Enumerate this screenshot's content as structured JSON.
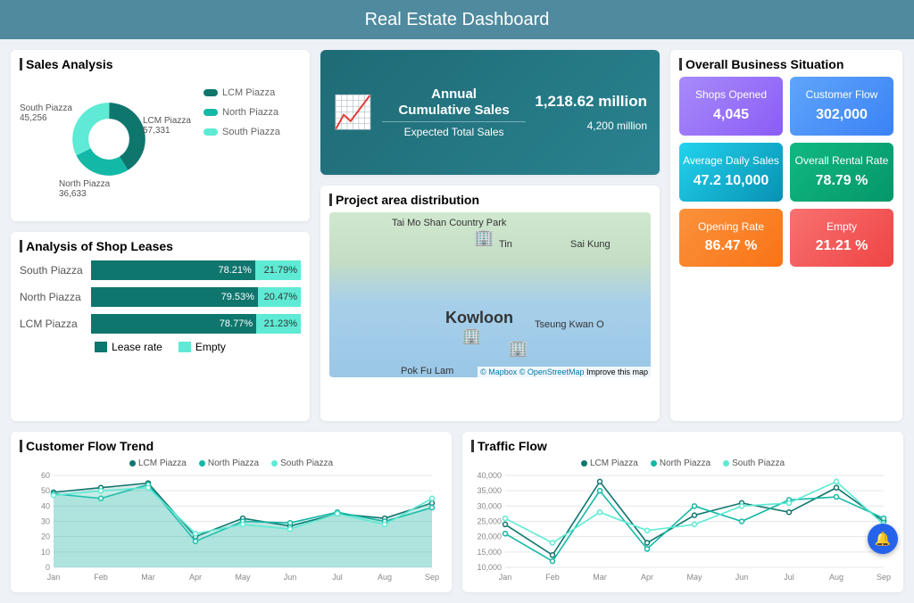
{
  "header": {
    "title": "Real Estate Dashboard"
  },
  "sales_analysis": {
    "title": "Sales Analysis",
    "items": [
      {
        "name": "LCM Piazza",
        "value": 57331,
        "label": "LCM Piazza\n57,331",
        "color": "#0f766e"
      },
      {
        "name": "North Piazza",
        "value": 36633,
        "label": "North Piazza\n36,633",
        "color": "#14b8a6"
      },
      {
        "name": "South Piazza",
        "value": 45256,
        "label": "South Piazza\n45,256",
        "color": "#5eead4"
      }
    ],
    "legend": [
      "LCM Piazza",
      "North Piazza",
      "South Piazza"
    ]
  },
  "kpi": {
    "title_line1": "Annual",
    "title_line2": "Cumulative Sales",
    "value": "1,218.62 million",
    "sub_title": "Expected Total Sales",
    "sub_value": "4,200 million"
  },
  "map": {
    "title": "Project area distribution",
    "city": "Kowloon",
    "labels": [
      "Tai Mo Shan Country Park",
      "Tin",
      "Sai Kung",
      "Tseung Kwan O",
      "Pok Fu Lam"
    ],
    "attribution": {
      "mapbox": "© Mapbox",
      "osm": "© OpenStreetMap",
      "improve": "Improve this map"
    }
  },
  "leases": {
    "title": "Analysis of Shop Leases",
    "rows": [
      {
        "name": "South Piazza",
        "lease": 78.21,
        "empty": 21.79
      },
      {
        "name": "North Piazza",
        "lease": 79.53,
        "empty": 20.47
      },
      {
        "name": "LCM Piazza",
        "lease": 78.77,
        "empty": 21.23
      }
    ],
    "legend": {
      "lease": "Lease rate",
      "empty": "Empty"
    }
  },
  "business": {
    "title": "Overall Business Situation",
    "tiles": [
      {
        "label": "Shops Opened",
        "value": "4,045",
        "bg": "linear-gradient(135deg,#a78bfa,#8b5cf6)"
      },
      {
        "label": "Customer Flow",
        "value": "302,000",
        "bg": "linear-gradient(135deg,#60a5fa,#3b82f6)"
      },
      {
        "label": "Average Daily Sales",
        "value": "47.2 10,000",
        "bg": "linear-gradient(135deg,#22d3ee,#0891b2)"
      },
      {
        "label": "Overall Rental Rate",
        "value": "78.79 %",
        "bg": "linear-gradient(135deg,#10b981,#059669)"
      },
      {
        "label": "Opening Rate",
        "value": "86.47 %",
        "bg": "linear-gradient(135deg,#fb923c,#f97316)"
      },
      {
        "label": "Empty",
        "value": "21.21 %",
        "bg": "linear-gradient(135deg,#f87171,#ef4444)"
      }
    ]
  },
  "customer_flow": {
    "title": "Customer Flow Trend",
    "legend": [
      "LCM Piazza",
      "North Piazza",
      "South Piazza"
    ]
  },
  "traffic_flow": {
    "title": "Traffic Flow",
    "legend": [
      "LCM Piazza",
      "North Piazza",
      "South Piazza"
    ]
  },
  "chart_data": [
    {
      "type": "pie",
      "title": "Sales Analysis",
      "series": [
        {
          "name": "Sales",
          "values": [
            57331,
            36633,
            45256
          ]
        }
      ],
      "categories": [
        "LCM Piazza",
        "North Piazza",
        "South Piazza"
      ]
    },
    {
      "type": "bar",
      "title": "Analysis of Shop Leases",
      "categories": [
        "South Piazza",
        "North Piazza",
        "LCM Piazza"
      ],
      "series": [
        {
          "name": "Lease rate",
          "values": [
            78.21,
            79.53,
            78.77
          ]
        },
        {
          "name": "Empty",
          "values": [
            21.79,
            20.47,
            21.23
          ]
        }
      ],
      "xlabel": "",
      "ylabel": "%",
      "ylim": [
        0,
        100
      ]
    },
    {
      "type": "area",
      "title": "Customer Flow Trend",
      "categories": [
        "Jan",
        "Feb",
        "Mar",
        "Apr",
        "May",
        "Jun",
        "Jul",
        "Aug",
        "Sep"
      ],
      "series": [
        {
          "name": "LCM Piazza",
          "values": [
            49,
            52,
            55,
            20,
            32,
            27,
            35,
            32,
            42
          ]
        },
        {
          "name": "North Piazza",
          "values": [
            48,
            45,
            54,
            17,
            30,
            29,
            36,
            30,
            39
          ]
        },
        {
          "name": "South Piazza",
          "values": [
            47,
            50,
            52,
            22,
            28,
            25,
            35,
            28,
            45
          ]
        }
      ],
      "xlabel": "",
      "ylabel": "",
      "ylim": [
        0,
        60
      ]
    },
    {
      "type": "line",
      "title": "Traffic Flow",
      "categories": [
        "Jan",
        "Feb",
        "Mar",
        "Apr",
        "May",
        "Jun",
        "Jul",
        "Aug",
        "Sep"
      ],
      "series": [
        {
          "name": "LCM Piazza",
          "values": [
            24000,
            14000,
            38000,
            18000,
            27000,
            31000,
            28000,
            36000,
            25000
          ]
        },
        {
          "name": "North Piazza",
          "values": [
            21000,
            12000,
            35000,
            16000,
            30000,
            25000,
            32000,
            33000,
            26000
          ]
        },
        {
          "name": "South Piazza",
          "values": [
            26000,
            18000,
            28000,
            22000,
            24000,
            30000,
            31000,
            38000,
            24000
          ]
        }
      ],
      "xlabel": "",
      "ylabel": "",
      "ylim": [
        10000,
        40000
      ]
    }
  ]
}
